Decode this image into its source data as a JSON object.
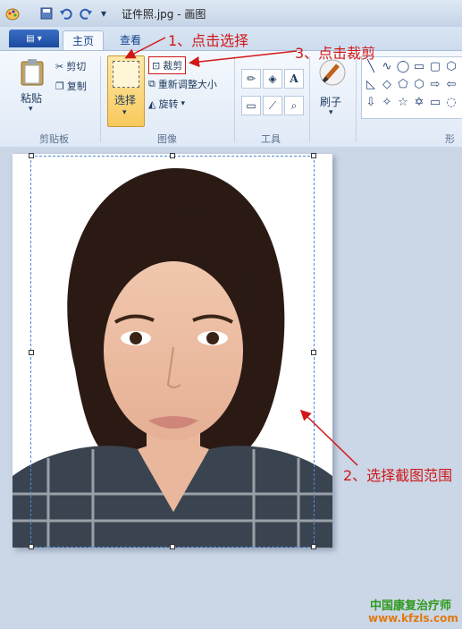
{
  "window": {
    "title": "证件照.jpg - 画图",
    "quick_access_icons": [
      "save-icon",
      "undo-icon",
      "redo-icon",
      "customize-icon"
    ]
  },
  "ribbon": {
    "tabs": [
      {
        "label": "主页",
        "active": true
      },
      {
        "label": "查看",
        "active": false
      }
    ],
    "clipboard": {
      "paste_label": "粘贴",
      "cut_label": "剪切",
      "copy_label": "复制",
      "group_label": "剪贴板"
    },
    "image": {
      "select_label": "选择",
      "crop_label": "裁剪",
      "resize_label": "重新调整大小",
      "rotate_label": "旋转",
      "group_label": "图像"
    },
    "tools": {
      "group_label": "工具"
    },
    "brushes": {
      "label": "刷子"
    },
    "shapes": {
      "group_label": "形状"
    }
  },
  "annotations": {
    "step1": "1、点击选择",
    "step2": "2、选择截图范围",
    "step3": "3、点击裁剪"
  },
  "watermark": {
    "line1": "中国康复治疗师",
    "line2": "www.kfzls.com"
  },
  "colors": {
    "annotation_red": "#d01818",
    "selection_blue": "#4a8bd6",
    "selected_button": "#fbd67e",
    "watermark_green": "#2e9a1e",
    "watermark_orange": "#e07a10"
  }
}
